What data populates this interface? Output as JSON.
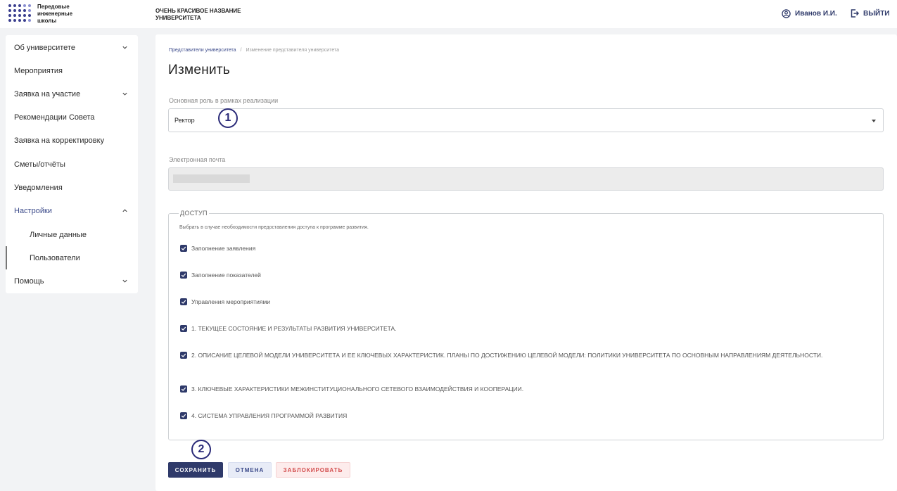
{
  "header": {
    "logo_text": "Передовые инженерные школы",
    "university_name": "ОЧЕНЬ КРАСИВОЕ НАЗВАНИЕ УНИВЕРСИТЕТА",
    "user_name": "Иванов И.И.",
    "logout_label": "ВЫЙТИ"
  },
  "sidebar": {
    "items": [
      {
        "label": "Об университете"
      },
      {
        "label": "Мероприятия"
      },
      {
        "label": "Заявка на участие"
      },
      {
        "label": "Рекомендации Совета"
      },
      {
        "label": "Заявка на корректировку"
      },
      {
        "label": "Сметы/отчёты"
      },
      {
        "label": "Уведомления"
      },
      {
        "label": "Настройки"
      },
      {
        "label": "Личные данные"
      },
      {
        "label": "Пользователи"
      },
      {
        "label": "Помощь"
      }
    ]
  },
  "breadcrumb": {
    "link": "Представители университета",
    "separator": "/",
    "current": "Изменение представителя университета"
  },
  "page_title": "Изменить",
  "role": {
    "label": "Основная роль в рамках реализации",
    "value": "Ректор"
  },
  "email": {
    "label": "Электронная почта"
  },
  "access": {
    "legend": "ДОСТУП",
    "hint": "Выбрать в случае необходимости предоставления доступа к программе развития.",
    "options": [
      {
        "label": "Заполнение заявления",
        "checked": true
      },
      {
        "label": "Заполнение показателей",
        "checked": true
      },
      {
        "label": "Управления мероприятиями",
        "checked": true
      },
      {
        "label": "1. ТЕКУЩЕЕ СОСТОЯНИЕ И РЕЗУЛЬТАТЫ РАЗВИТИЯ УНИВЕРСИТЕТА.",
        "checked": true
      },
      {
        "label": "2. ОПИСАНИЕ ЦЕЛЕВОЙ МОДЕЛИ УНИВЕРСИТЕТА И ЕЕ КЛЮЧЕВЫХ ХАРАКТЕРИСТИК. ПЛАНЫ ПО ДОСТИЖЕНИЮ ЦЕЛЕВОЙ МОДЕЛИ: ПОЛИТИКИ УНИВЕРСИТЕТА ПО ОСНОВНЫМ НАПРАВЛЕНИЯМ ДЕЯТЕЛЬНОСТИ.",
        "checked": true
      },
      {
        "label": "3. КЛЮЧЕВЫЕ ХАРАКТЕРИСТИКИ МЕЖИНСТИТУЦИОНАЛЬНОГО СЕТЕВОГО ВЗАИМОДЕЙСТВИЯ И КООПЕРАЦИИ.",
        "checked": true
      },
      {
        "label": "4. СИСТЕМА УПРАВЛЕНИЯ ПРОГРАММОЙ РАЗВИТИЯ",
        "checked": true
      }
    ]
  },
  "buttons": {
    "save": "СОХРАНИТЬ",
    "cancel": "ОТМЕНА",
    "block": "ЗАБЛОКИРОВАТЬ"
  },
  "annotations": {
    "one": "1",
    "two": "2"
  },
  "colors": {
    "primary": "#2f3a6a",
    "danger": "#d24d4d",
    "annotation": "#2a2a78"
  }
}
